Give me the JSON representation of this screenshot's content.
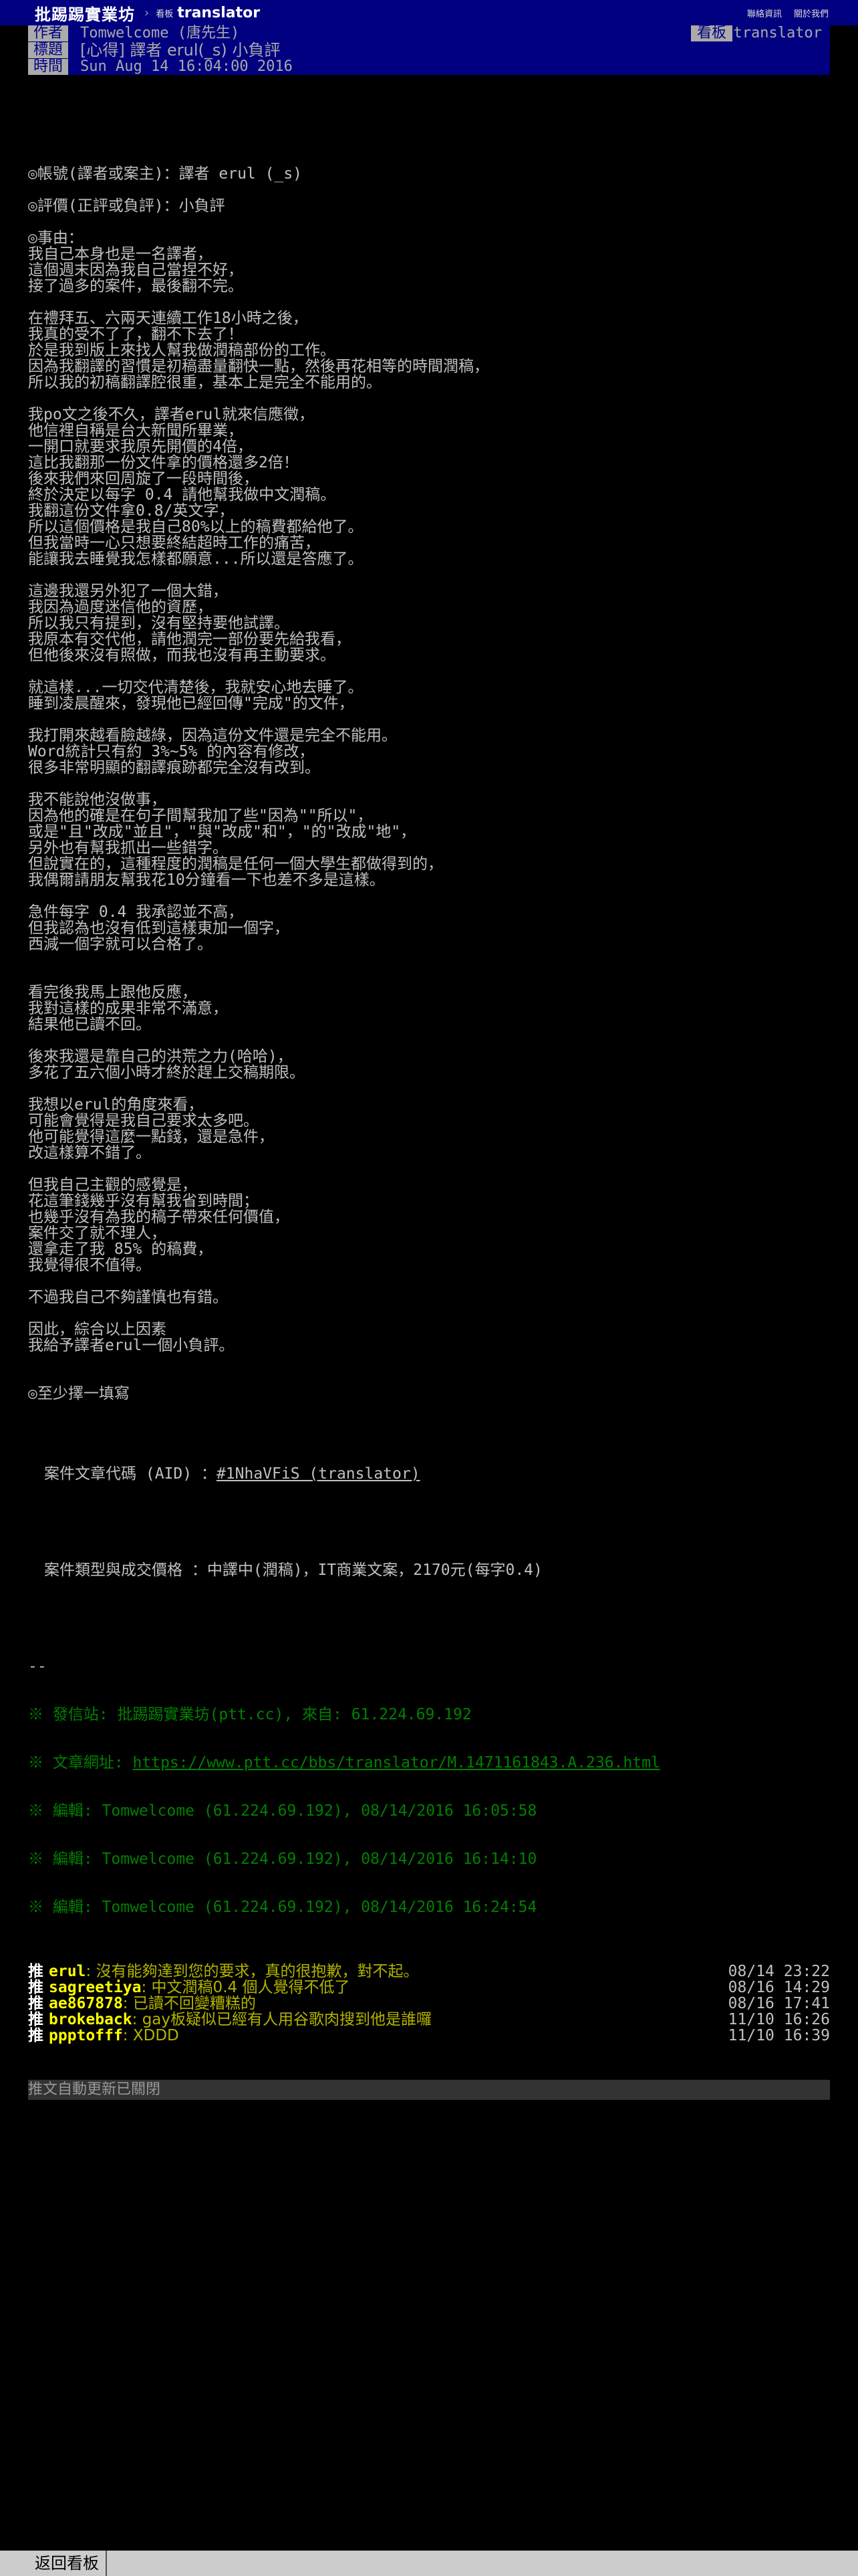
{
  "topbar": {
    "site_name": "批踢踢實業坊",
    "separator": "›",
    "board_label_small": "看板",
    "board_name": "translator",
    "links": [
      "聯絡資訊",
      "關於我們"
    ]
  },
  "meta": {
    "author_tag": "作者",
    "author": "Tomwelcome (唐先生)",
    "board_tag": "看板",
    "board": "translator",
    "title_tag": "標題",
    "title": "[心得] 譯者 erul(_s) 小負評",
    "time_tag": "時間",
    "time": "Sun Aug 14 16:04:00 2016"
  },
  "body": {
    "lines_1": [
      "",
      "◎帳號(譯者或案主)：譯者 erul (_s)",
      "",
      "◎評價(正評或負評)：小負評",
      "",
      "◎事由：",
      "我自己本身也是一名譯者，",
      "這個週末因為我自己當捏不好，",
      "接了過多的案件，最後翻不完。",
      "",
      "在禮拜五、六兩天連續工作18小時之後，",
      "我真的受不了了，翻不下去了！",
      "於是我到版上來找人幫我做潤稿部份的工作。",
      "因為我翻譯的習慣是初稿盡量翻快一點，然後再花相等的時間潤稿，",
      "所以我的初稿翻譯腔很重，基本上是完全不能用的。",
      "",
      "我po文之後不久，譯者erul就來信應徵，",
      "他信裡自稱是台大新聞所畢業，",
      "一開口就要求我原先開價的4倍，",
      "這比我翻那一份文件拿的價格還多2倍！",
      "後來我們來回周旋了一段時間後，",
      "終於決定以每字 0.4 請他幫我做中文潤稿。",
      "我翻這份文件拿0.8/英文字，",
      "所以這個價格是我自己80%以上的稿費都給他了。",
      "但我當時一心只想要終結超時工作的痛苦，",
      "能讓我去睡覺我怎樣都願意...所以還是答應了。",
      "",
      "這邊我還另外犯了一個大錯，",
      "我因為過度迷信他的資歷，",
      "所以我只有提到，沒有堅持要他試譯。",
      "我原本有交代他，請他潤完一部份要先給我看，",
      "但他後來沒有照做，而我也沒有再主動要求。",
      "",
      "就這樣...一切交代清楚後，我就安心地去睡了。",
      "睡到凌晨醒來，發現他已經回傳\"完成\"的文件，",
      "",
      "我打開來越看臉越綠，因為這份文件還是完全不能用。",
      "Word統計只有約 3%~5% 的內容有修改，",
      "很多非常明顯的翻譯痕跡都完全沒有改到。",
      "",
      "我不能說他沒做事，",
      "因為他的確是在句子間幫我加了些\"因為\"\"所以\"，",
      "或是\"且\"改成\"並且\"，\"與\"改成\"和\"，\"的\"改成\"地\"，",
      "另外也有幫我抓出一些錯字。",
      "但說實在的，這種程度的潤稿是任何一個大學生都做得到的，",
      "我偶爾請朋友幫我花10分鐘看一下也差不多是這樣。",
      "",
      "急件每字 0.4 我承認並不高，",
      "但我認為也沒有低到這樣東加一個字，",
      "西減一個字就可以合格了。",
      "",
      "",
      "看完後我馬上跟他反應，",
      "我對這樣的成果非常不滿意，",
      "結果他已讀不回。",
      "",
      "後來我還是靠自己的洪荒之力(哈哈)，",
      "多花了五六個小時才終於趕上交稿期限。",
      "",
      "我想以erul的角度來看，",
      "可能會覺得是我自己要求太多吧。",
      "他可能覺得這麼一點錢，還是急件，",
      "改這樣算不錯了。",
      "",
      "但我自己主觀的感覺是，",
      "花這筆錢幾乎沒有幫我省到時間；",
      "也幾乎沒有為我的稿子帶來任何價值，",
      "案件交了就不理人，",
      "還拿走了我 85% 的稿費，",
      "我覺得很不值得。",
      "",
      "不過我自己不夠謹慎也有錯。",
      "",
      "因此，綜合以上因素",
      "我給予譯者erul一個小負評。",
      "",
      "",
      "◎至少擇一填寫",
      ""
    ],
    "aid_label": "案件文章代碼 (AID) ：",
    "aid_value": "#1NhaVFiS (translator)",
    "blank_after_aid": "",
    "type_label": "案件類型與成交價格 ：中譯中(潤稿)，IT商業文案，2170元(每字0.4)",
    "blank_after_type": "",
    "signature": "--",
    "from_line": "※ 發信站: 批踢踢實業坊(ptt.cc), 來自: 61.224.69.192",
    "url_label": "※ 文章網址: ",
    "url": "https://www.ptt.cc/bbs/translator/M.1471161843.A.236.html",
    "edits": [
      "※ 編輯: Tomwelcome (61.224.69.192), 08/14/2016 16:05:58",
      "※ 編輯: Tomwelcome (61.224.69.192), 08/14/2016 16:14:10",
      "※ 編輯: Tomwelcome (61.224.69.192), 08/14/2016 16:24:54"
    ]
  },
  "pushes": [
    {
      "tag": "推 ",
      "user": "erul",
      "content": ": 沒有能夠達到您的要求，真的很抱歉，對不起。",
      "time": "08/14 23:22"
    },
    {
      "tag": "推 ",
      "user": "sagreetiya",
      "content": ": 中文潤稿0.4 個人覺得不低了",
      "time": "08/16 14:29"
    },
    {
      "tag": "推 ",
      "user": "ae867878",
      "content": ": 已讀不回變糟糕的",
      "time": "08/16 17:41"
    },
    {
      "tag": "推 ",
      "user": "brokeback",
      "content": ": gay板疑似已經有人用谷歌肉搜到他是誰囉",
      "time": "11/10 16:26"
    },
    {
      "tag": "推 ",
      "user": "ppptofff",
      "content": ": XDDD",
      "time": "11/10 16:39"
    }
  ],
  "push_footer": "推文自動更新已關閉",
  "bottombar": {
    "back_label": "返回看板"
  }
}
